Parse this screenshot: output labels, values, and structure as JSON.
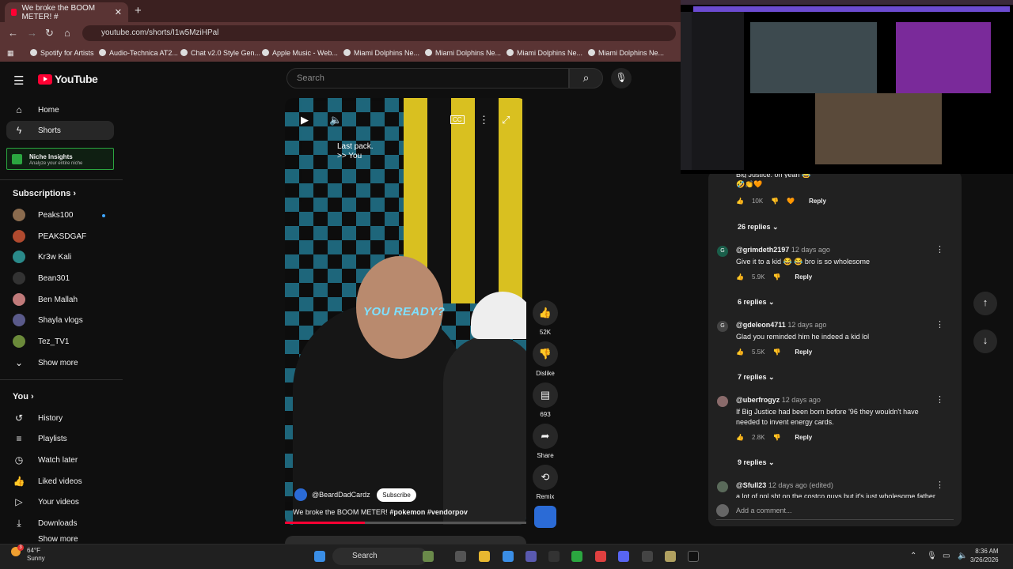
{
  "browser": {
    "tab_title": "We broke the BOOM METER! #",
    "tab_close": "✕",
    "new_tab": "+",
    "url": "youtube.com/shorts/I1w5MziHPal",
    "bookmarks": [
      "Spotify for Artists",
      "Audio-Technica AT2...",
      "Chat v2.0 Style Gen...",
      "Apple Music - Web...",
      "Miami Dolphins Ne...",
      "Miami Dolphins Ne...",
      "Miami Dolphins Ne...",
      "Miami Dolphins Ne..."
    ]
  },
  "header": {
    "logo_text": "YouTube",
    "search_placeholder": "Search"
  },
  "sidebar": {
    "home": "Home",
    "shorts": "Shorts",
    "niche_title": "Niche Insights",
    "niche_sub": "Analyze your entire niche",
    "subscriptions": "Subscriptions",
    "subs": [
      "Peaks100",
      "PEAKSDGAF",
      "Kr3w Kali",
      "Bean301",
      "Ben Mallah",
      "Shayla vlogs",
      "Tez_TV1"
    ],
    "show_more": "Show more",
    "you": "You",
    "you_items": [
      "History",
      "Playlists",
      "Watch later",
      "Liked videos",
      "Your videos",
      "Downloads"
    ],
    "cut_item": "Show more"
  },
  "video": {
    "caption_line1": "Last pack.",
    "caption_line2": ">> You",
    "overlay_text": "YOU READY?",
    "channel": "@BeardDadCardz",
    "subscribe": "Subscribe",
    "title_plain": "We broke the BOOM METER! ",
    "title_tags": "#pokemon #vendorpov",
    "cc": "CC",
    "progress": 0.33
  },
  "actions": {
    "likes": "52K",
    "dislike": "Dislike",
    "comments": "693",
    "share": "Share",
    "remix": "Remix"
  },
  "comments": {
    "partial_text": "Big Justice: oh yeah 😂",
    "partial_emoji": "🤣👏🧡",
    "partial_likes": "10K",
    "reply": "Reply",
    "list": [
      {
        "replies": "26 replies"
      },
      {
        "initial": "G",
        "user": "@grimdeth2197",
        "time": "12 days ago",
        "text": "Give it to a kid 😂 😂 bro is so wholesome",
        "likes": "5.9K",
        "replies": "6 replies"
      },
      {
        "initial": "G",
        "user": "@gdeleon4711",
        "time": "12 days ago",
        "text": "Glad you reminded him he indeed a kid lol",
        "likes": "5.5K",
        "replies": "7 replies"
      },
      {
        "initial": "",
        "user": "@uberfrogyz",
        "time": "12 days ago",
        "text": "If Big Justice had been born before '96 they wouldn't have",
        "text2": "needed to invent energy cards.",
        "likes": "2.8K",
        "replies": "9 replies"
      },
      {
        "initial": "",
        "user": "@Sfull23",
        "time": "12 days ago (edited)",
        "text": "a lot of npl sht on the costco guys but it's just wholesome father"
      }
    ],
    "add_placeholder": "Add a comment..."
  },
  "taskbar": {
    "temp": "64°F",
    "weather": "Sunny",
    "badge": "3",
    "search": "Search",
    "time": "8:36 AM",
    "date": "3/26/2026"
  },
  "colors": {
    "accent": "#ff0033",
    "niche": "#2ba640",
    "chrome": "#5a3434"
  }
}
